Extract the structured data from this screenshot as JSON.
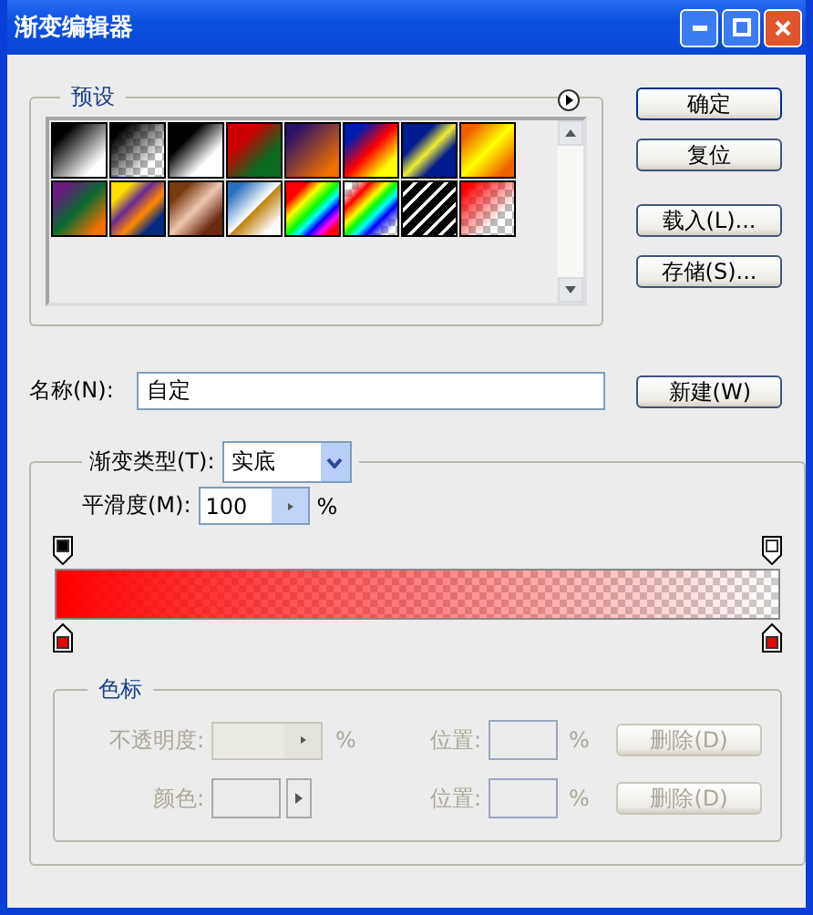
{
  "window": {
    "title": "渐变编辑器"
  },
  "presets": {
    "legend": "预设"
  },
  "buttons": [
    {
      "label": "确定",
      "default": true
    },
    {
      "label": "复位",
      "default": false
    },
    {
      "label": "载入(L)...",
      "default": false
    },
    {
      "label": "存储(S)...",
      "default": false
    }
  ],
  "name_field": {
    "label": "名称(N):",
    "value": "自定",
    "button": "新建(W)"
  },
  "gradient": {
    "type_label": "渐变类型(T):",
    "type_value": "实底",
    "smoothness_label": "平滑度(M):",
    "smoothness_value": "100",
    "smoothness_unit": "%"
  },
  "stops": {
    "legend": "色标",
    "rows": [
      {
        "kind": "opacity",
        "label": "不透明度:",
        "unit": "%",
        "position_label": "位置:",
        "position_unit": "%",
        "delete": "删除(D)",
        "disabled": true
      },
      {
        "kind": "color",
        "label": "颜色:",
        "position_label": "位置:",
        "position_unit": "%",
        "delete": "删除(D)",
        "disabled": true
      }
    ]
  }
}
